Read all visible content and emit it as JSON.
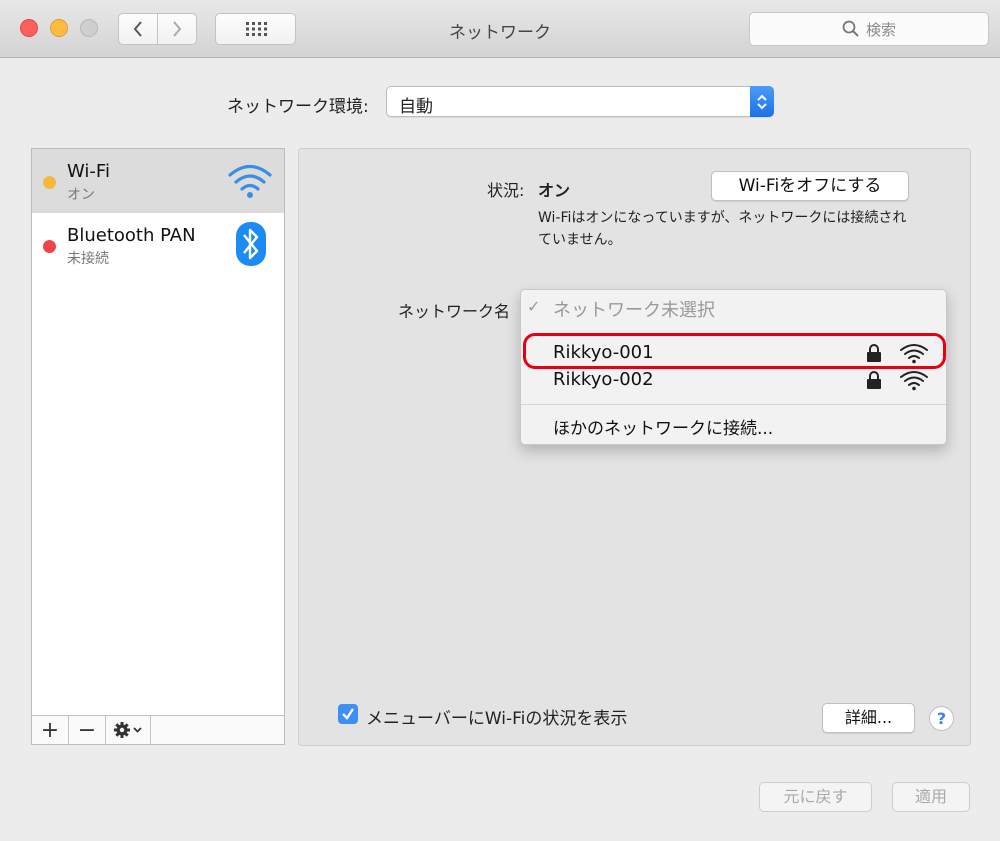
{
  "window": {
    "title": "ネットワーク",
    "search_placeholder": "検索"
  },
  "location": {
    "label": "ネットワーク環境:",
    "value": "自動"
  },
  "services": [
    {
      "name": "Wi-Fi",
      "status": "オン",
      "dot_color": "#f6b73c",
      "icon": "wifi-icon"
    },
    {
      "name": "Bluetooth PAN",
      "status": "未接続",
      "dot_color": "#f0434b",
      "icon": "bluetooth-icon"
    }
  ],
  "service_toolbar": {
    "add": "+",
    "remove": "−",
    "action_icon": "gear-icon"
  },
  "detail": {
    "status_label": "状況:",
    "status_value": "オン",
    "wifi_off_button": "Wi-Fiをオフにする",
    "status_description": "Wi-Fiはオンになっていますが、ネットワークには接続されていません。",
    "network_name_label": "ネットワーク名",
    "show_in_menubar_label": "メニューバーにWi-Fiの状況を表示",
    "show_in_menubar_checked": true,
    "advanced_button": "詳細...",
    "help_button": "?"
  },
  "network_menu": {
    "selected": "ネットワーク未選択",
    "networks": [
      {
        "name": "Rikkyo-001",
        "locked": true,
        "highlighted": true
      },
      {
        "name": "Rikkyo-002",
        "locked": true,
        "highlighted": false
      }
    ],
    "other": "ほかのネットワークに接続..."
  },
  "footer": {
    "revert_button": "元に戻す",
    "apply_button": "適用"
  },
  "colors": {
    "highlight_border": "#e60012",
    "accent_blue": "#3d8ff5"
  }
}
